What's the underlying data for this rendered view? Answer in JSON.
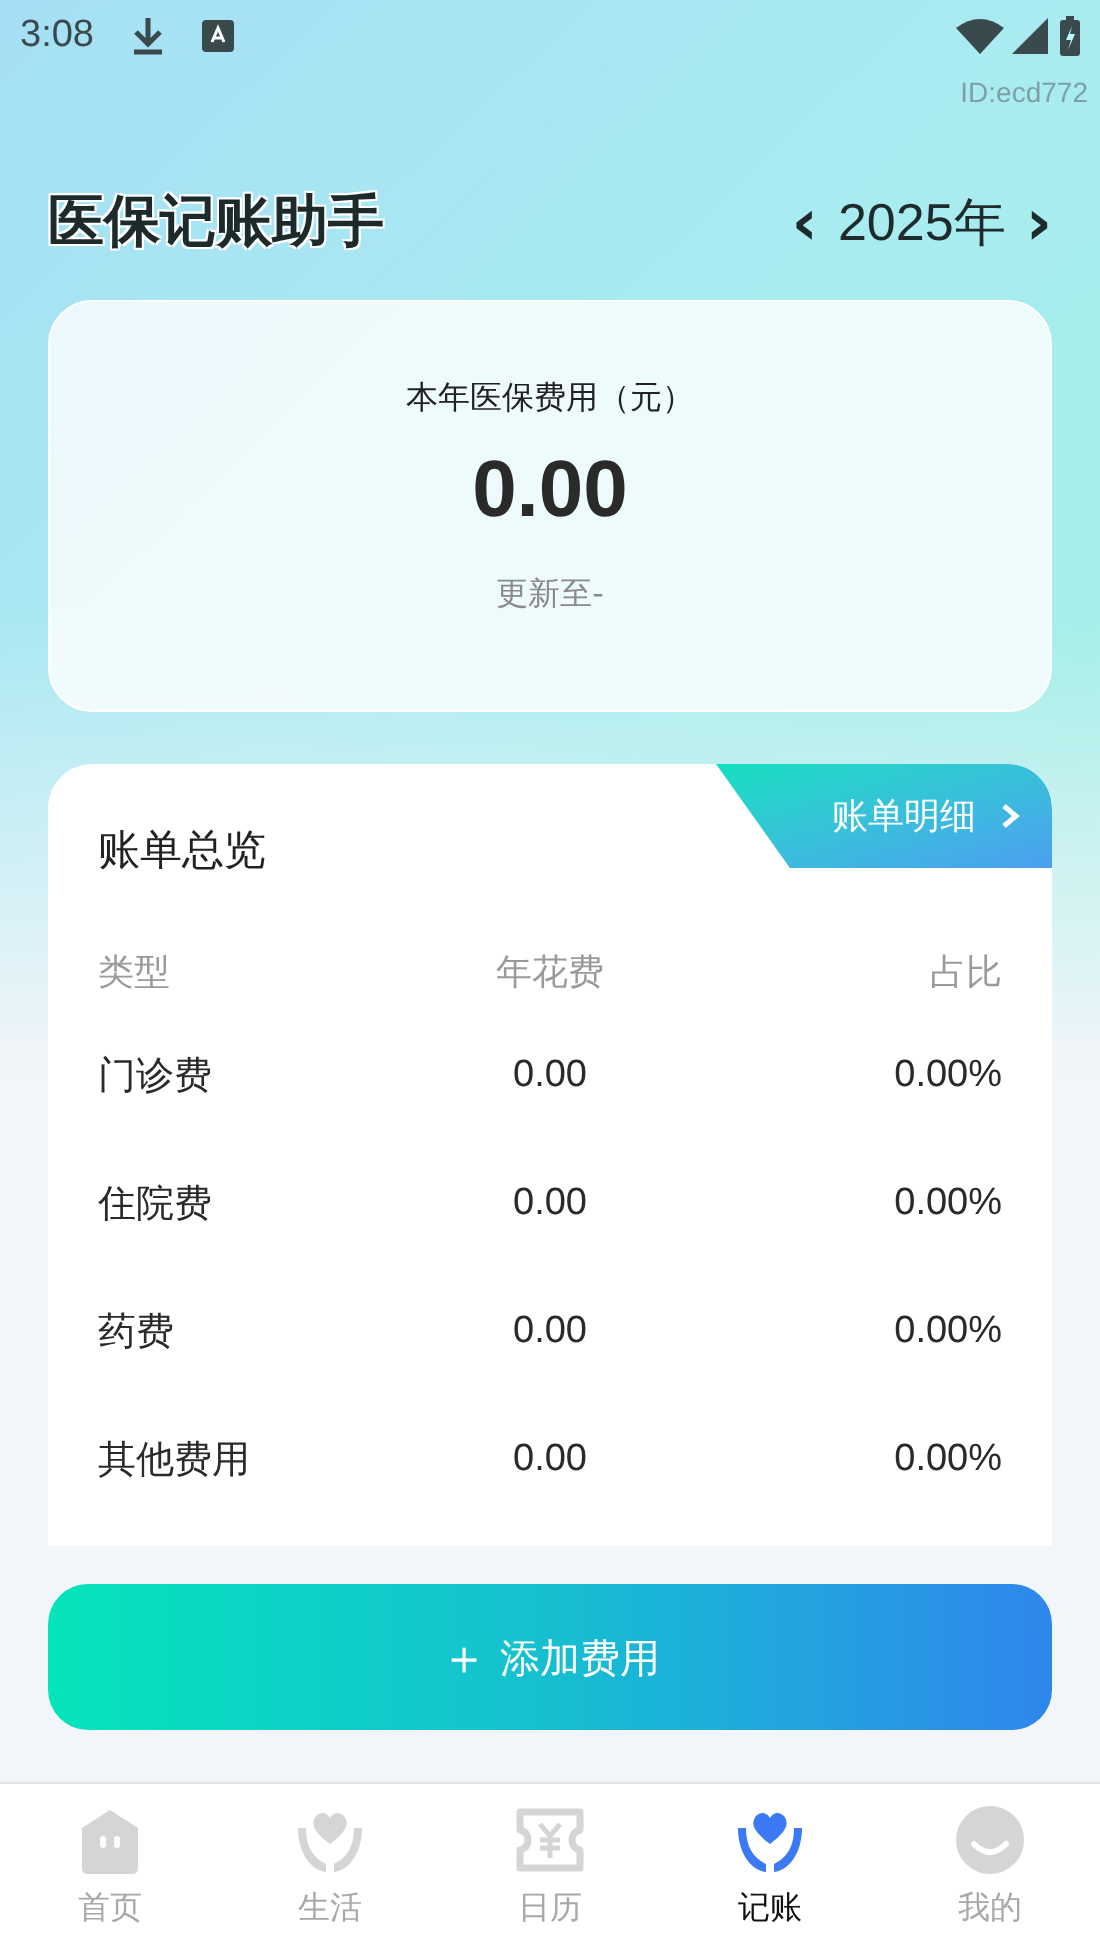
{
  "status_bar": {
    "time": "3:08"
  },
  "device_id": "ID:ecd772",
  "header": {
    "title": "医保记账助手",
    "prev": "‹",
    "year": "2025年",
    "next": "›"
  },
  "summary": {
    "label": "本年医保费用（元）",
    "amount": "0.00",
    "updated": "更新至-"
  },
  "bill": {
    "title": "账单总览",
    "detail_link": "账单明细",
    "columns": [
      "类型",
      "年花费",
      "占比"
    ],
    "rows": [
      {
        "type": "门诊费",
        "cost": "0.00",
        "share": "0.00%"
      },
      {
        "type": "住院费",
        "cost": "0.00",
        "share": "0.00%"
      },
      {
        "type": "药费",
        "cost": "0.00",
        "share": "0.00%"
      },
      {
        "type": "其他费用",
        "cost": "0.00",
        "share": "0.00%"
      }
    ]
  },
  "add_button": {
    "icon": "＋",
    "label": "添加费用"
  },
  "tabs": [
    {
      "label": "首页",
      "selected": false
    },
    {
      "label": "生活",
      "selected": false
    },
    {
      "label": "日历",
      "selected": false
    },
    {
      "label": "记账",
      "selected": true
    },
    {
      "label": "我的",
      "selected": false
    }
  ]
}
